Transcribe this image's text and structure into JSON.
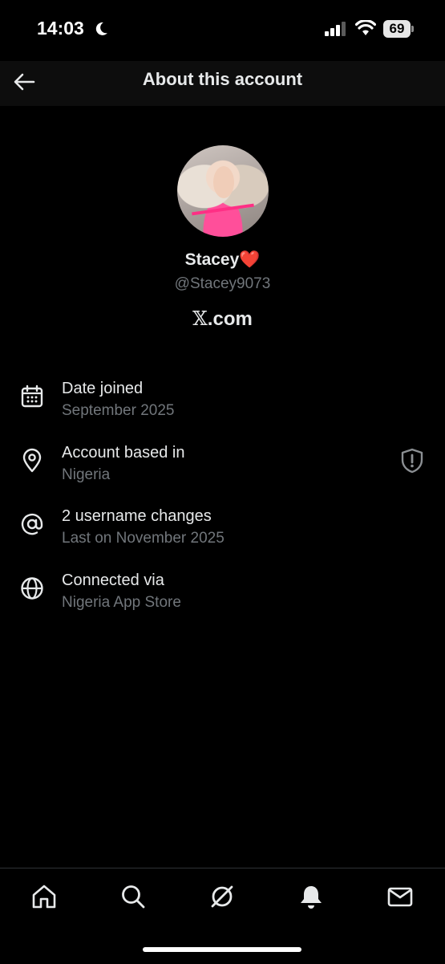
{
  "status_bar": {
    "time": "14:03",
    "battery": "69"
  },
  "header": {
    "title": "About this account"
  },
  "profile": {
    "display_name": "Stacey",
    "emoji": "❤️",
    "handle": "@Stacey9073",
    "site": {
      "logo": "𝕏",
      "suffix": ".com"
    }
  },
  "info": [
    {
      "icon": "calendar-icon",
      "title": "Date joined",
      "subtitle": "September 2025"
    },
    {
      "icon": "location-pin-icon",
      "title": "Account based in",
      "subtitle": "Nigeria",
      "trailing_icon": "shield-alert-icon"
    },
    {
      "icon": "at-sign-icon",
      "title": "2 username changes",
      "subtitle": "Last on November 2025"
    },
    {
      "icon": "globe-icon",
      "title": "Connected via",
      "subtitle": "Nigeria App Store"
    }
  ],
  "bottom_nav": [
    "home-icon",
    "search-icon",
    "grok-icon",
    "notifications-icon",
    "messages-icon"
  ],
  "colors": {
    "background": "#000000",
    "header_background": "#0d0d0d",
    "primary_text": "#e7e9ea",
    "secondary_text": "#71767b"
  }
}
